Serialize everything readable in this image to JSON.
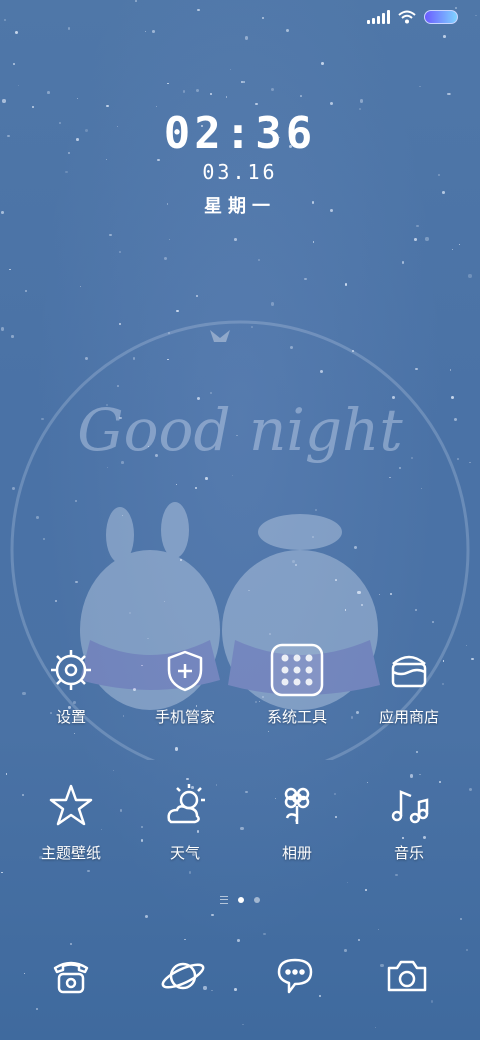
{
  "status_bar": {
    "battery_color_start": "#6b5cff",
    "battery_color_end": "#7fd3ff"
  },
  "lockclock": {
    "time": "02:36",
    "date": "03.16",
    "weekday": "星期一"
  },
  "wallpaper": {
    "text": "Good night"
  },
  "apps_row1": [
    {
      "label": "设置",
      "icon": "gear-icon"
    },
    {
      "label": "手机管家",
      "icon": "shield-plus-icon"
    },
    {
      "label": "系统工具",
      "icon": "folder-grid-icon"
    },
    {
      "label": "应用商店",
      "icon": "cake-store-icon"
    }
  ],
  "apps_row2": [
    {
      "label": "主题壁纸",
      "icon": "star-icon"
    },
    {
      "label": "天气",
      "icon": "sun-cloud-icon"
    },
    {
      "label": "相册",
      "icon": "flower-icon"
    },
    {
      "label": "音乐",
      "icon": "music-note-icon"
    }
  ],
  "page_indicator": {
    "pages": 2,
    "current": 1
  },
  "dock": [
    {
      "icon": "phone-icon"
    },
    {
      "icon": "planet-icon"
    },
    {
      "icon": "chat-bubble-icon"
    },
    {
      "icon": "camera-icon"
    }
  ],
  "colors": {
    "background": "#4a72a6",
    "icon_stroke": "#ffffff"
  }
}
